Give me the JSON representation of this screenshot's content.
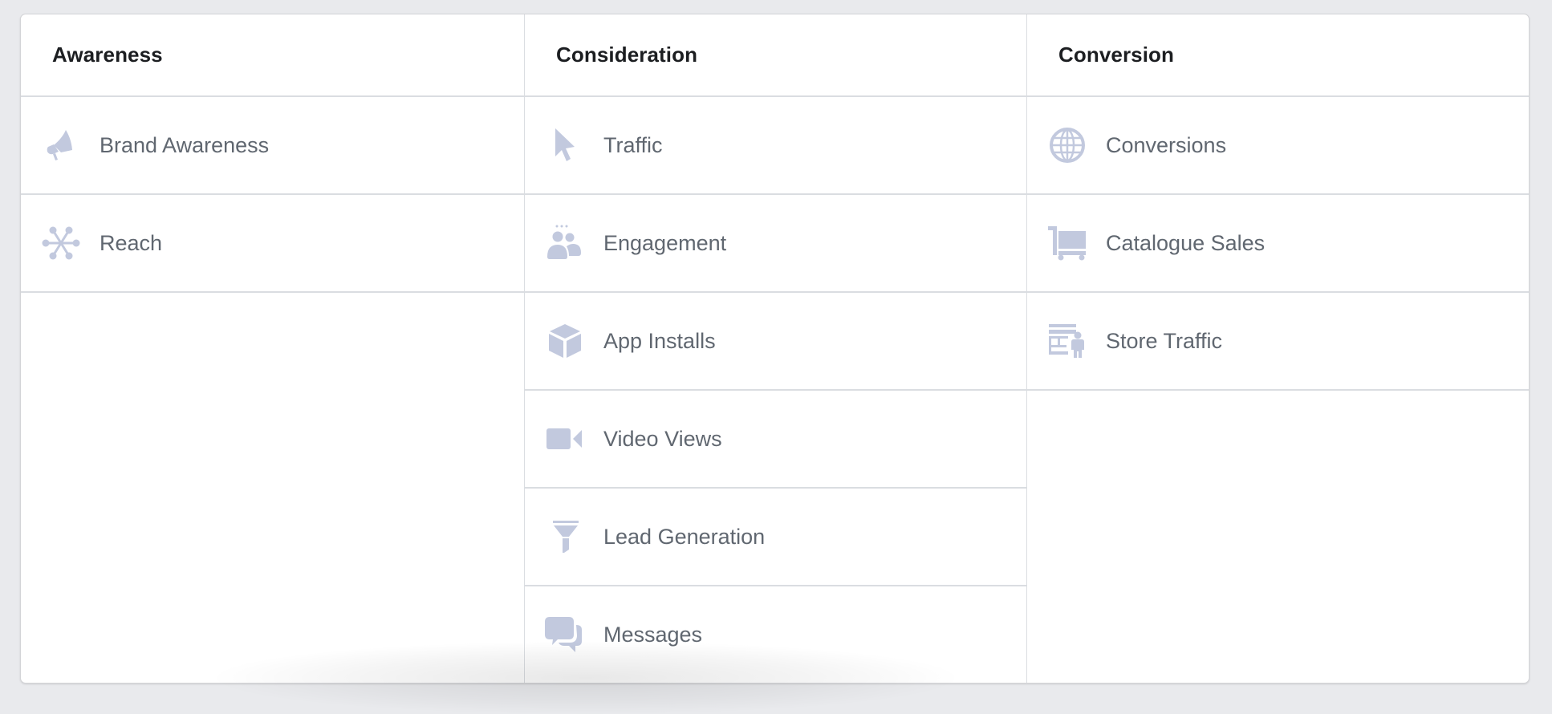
{
  "colors": {
    "background": "#e9eaed",
    "card": "#ffffff",
    "divider": "#dadde1",
    "header_text": "#1c1e21",
    "item_text": "#606770",
    "icon": "#c2c9de"
  },
  "columns": [
    {
      "title": "Awareness",
      "items": [
        {
          "label": "Brand Awareness",
          "icon": "megaphone-icon"
        },
        {
          "label": "Reach",
          "icon": "reach-network-icon"
        }
      ]
    },
    {
      "title": "Consideration",
      "items": [
        {
          "label": "Traffic",
          "icon": "cursor-icon"
        },
        {
          "label": "Engagement",
          "icon": "people-icon"
        },
        {
          "label": "App Installs",
          "icon": "cube-icon"
        },
        {
          "label": "Video Views",
          "icon": "video-camera-icon"
        },
        {
          "label": "Lead Generation",
          "icon": "funnel-icon"
        },
        {
          "label": "Messages",
          "icon": "chat-bubbles-icon"
        }
      ]
    },
    {
      "title": "Conversion",
      "items": [
        {
          "label": "Conversions",
          "icon": "globe-icon"
        },
        {
          "label": "Catalogue Sales",
          "icon": "shopping-cart-icon"
        },
        {
          "label": "Store Traffic",
          "icon": "store-visitor-icon"
        }
      ]
    }
  ]
}
